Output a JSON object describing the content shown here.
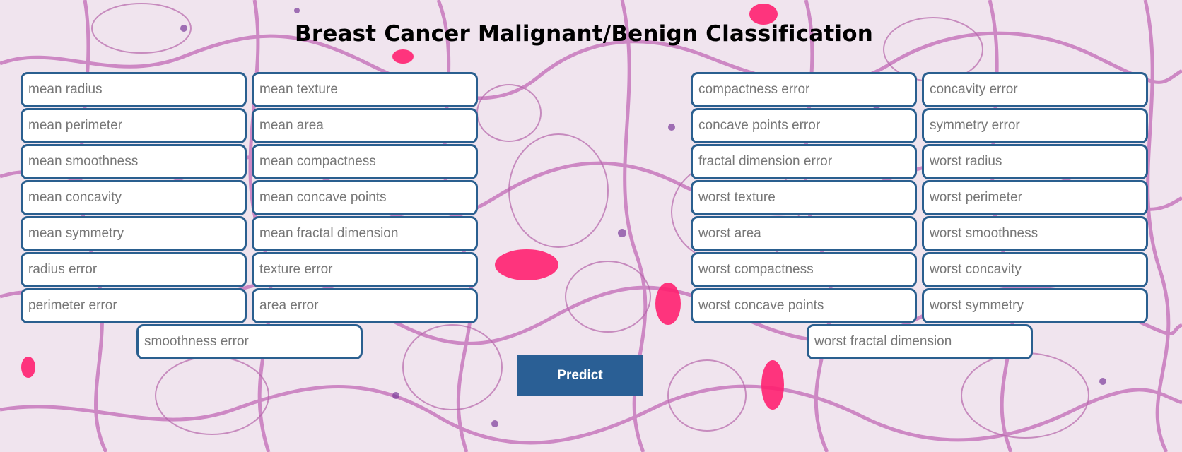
{
  "page": {
    "title": "Breast Cancer Malignant/Benign Classification"
  },
  "form": {
    "fields_left": [
      "mean radius",
      "mean texture",
      "mean perimeter",
      "mean area",
      "mean smoothness",
      "mean compactness",
      "mean concavity",
      "mean concave points",
      "mean symmetry",
      "mean fractal dimension",
      "radius error",
      "texture error",
      "perimeter error",
      "area error",
      "smoothness error"
    ],
    "fields_right": [
      "compactness error",
      "concavity error",
      "concave points error",
      "symmetry error",
      "fractal dimension error",
      "worst radius",
      "worst texture",
      "worst perimeter",
      "worst area",
      "worst smoothness",
      "worst compactness",
      "worst concavity",
      "worst concave points",
      "worst symmetry",
      "worst fractal dimension"
    ],
    "submit_label": "Predict"
  },
  "colors": {
    "field_border": "#2a5f8f",
    "button_bg": "#2a5f95",
    "tissue_pink": "#d98ccc",
    "blood_red": "#ff1a6e"
  }
}
